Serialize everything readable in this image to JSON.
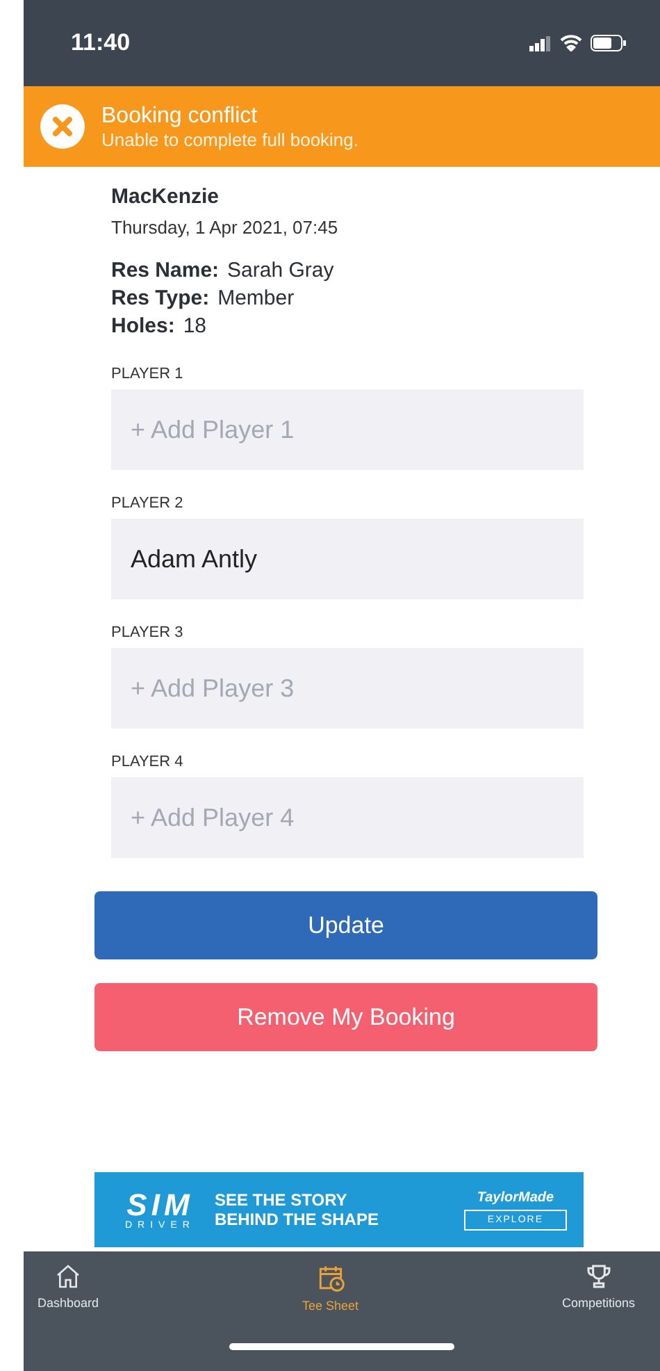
{
  "status_bar": {
    "time": "11:40"
  },
  "alert": {
    "title": "Booking conflict",
    "message": "Unable to complete full booking."
  },
  "booking": {
    "course": "MacKenzie",
    "datetime": "Thursday, 1 Apr 2021, 07:45",
    "details": [
      {
        "label": "Res Name:",
        "value": "Sarah Gray"
      },
      {
        "label": "Res Type:",
        "value": "Member"
      },
      {
        "label": "Holes:",
        "value": "18"
      }
    ]
  },
  "players": [
    {
      "label": "PLAYER 1",
      "placeholder": "+ Add Player 1"
    },
    {
      "label": "PLAYER 2",
      "value": "Adam Antly"
    },
    {
      "label": "PLAYER 3",
      "placeholder": "+ Add Player 3"
    },
    {
      "label": "PLAYER 4",
      "placeholder": "+ Add Player 4"
    }
  ],
  "buttons": [
    {
      "label": "Update",
      "kind": "primary"
    },
    {
      "label": "Remove My Booking",
      "kind": "danger"
    }
  ],
  "ad": {
    "logo": "SIM",
    "logo_sub": "DRIVER",
    "headline": [
      "SEE THE STORY",
      "BEHIND THE SHAPE"
    ],
    "brand": "TaylorMade",
    "cta": "EXPLORE"
  },
  "tabs": [
    {
      "label": "Dashboard",
      "kind": "home",
      "selected": false
    },
    {
      "label": "Tee Sheet",
      "kind": "calendar",
      "selected": true
    },
    {
      "label": "Competitions",
      "kind": "trophy",
      "selected": false
    }
  ]
}
